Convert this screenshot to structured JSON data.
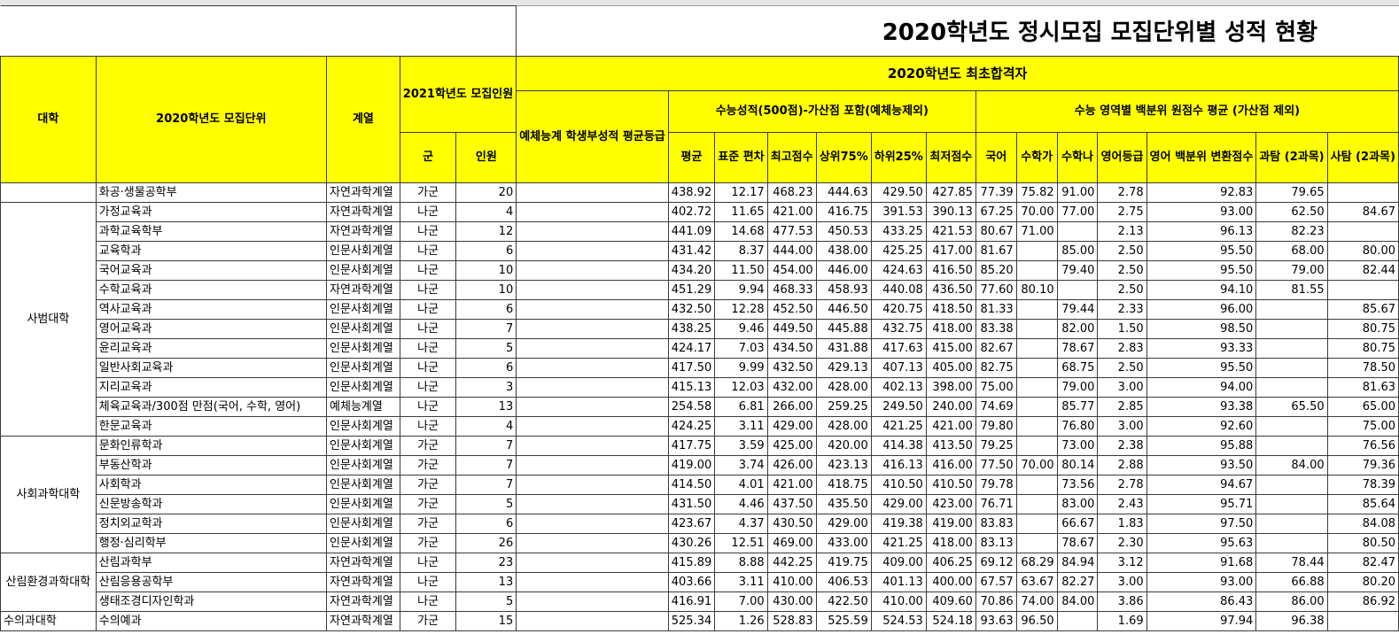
{
  "title": "2020학년도 정시모집 모집단위별 성적 현황",
  "headers": {
    "univ": "대학",
    "unit": "2020학년도 모집단위",
    "track": "계열",
    "quota2021": "2021학년도 모집인원",
    "group": "군",
    "count": "인원",
    "result_group": "2020학년도 최초합격자",
    "arts_grade": "예체능계 학생부성적 평균등급",
    "suneung_total": "수능성적(500점)-가산점 포함(예체능제외)",
    "avg": "평균",
    "std": "표준 편차",
    "max": "최고점수",
    "top75": "상위75%",
    "bottom25": "하위25%",
    "min": "최저점수",
    "pct_group": "수능 영역별 백분위 원점수 평균 (가산점 제외)",
    "korean": "국어",
    "math_ga": "수학가",
    "math_na": "수학나",
    "eng_grade": "영어등급",
    "eng_conv": "영어 백분위 변환점수",
    "sci": "과탐 (2과목)",
    "soc": "사탐 (2과목)"
  },
  "colleges": [
    {
      "name": "",
      "rows": [
        [
          "화공·생물공학부",
          "자연과학계열",
          "가군",
          "20",
          "",
          "438.92",
          "12.17",
          "468.23",
          "444.63",
          "429.50",
          "427.85",
          "77.39",
          "75.82",
          "91.00",
          "2.78",
          "92.83",
          "79.65",
          ""
        ]
      ]
    },
    {
      "name": "사범대학",
      "rows": [
        [
          "가정교육과",
          "자연과학계열",
          "나군",
          "4",
          "",
          "402.72",
          "11.65",
          "421.00",
          "416.75",
          "391.53",
          "390.13",
          "67.25",
          "70.00",
          "77.00",
          "2.75",
          "93.00",
          "62.50",
          "84.67"
        ],
        [
          "과학교육학부",
          "자연과학계열",
          "나군",
          "12",
          "",
          "441.09",
          "14.68",
          "477.53",
          "450.53",
          "433.25",
          "421.53",
          "80.67",
          "71.00",
          "",
          "2.13",
          "96.13",
          "82.23",
          ""
        ],
        [
          "교육학과",
          "인문사회계열",
          "나군",
          "6",
          "",
          "431.42",
          "8.37",
          "444.00",
          "438.00",
          "425.25",
          "417.00",
          "81.67",
          "",
          "85.00",
          "2.50",
          "95.50",
          "68.00",
          "80.00"
        ],
        [
          "국어교육과",
          "인문사회계열",
          "나군",
          "10",
          "",
          "434.20",
          "11.50",
          "454.00",
          "446.00",
          "424.63",
          "416.50",
          "85.20",
          "",
          "79.40",
          "2.50",
          "95.50",
          "79.00",
          "82.44"
        ],
        [
          "수학교육과",
          "자연과학계열",
          "나군",
          "10",
          "",
          "451.29",
          "9.94",
          "468.33",
          "458.93",
          "440.08",
          "436.50",
          "77.60",
          "80.10",
          "",
          "2.50",
          "94.10",
          "81.55",
          ""
        ],
        [
          "역사교육과",
          "인문사회계열",
          "나군",
          "6",
          "",
          "432.50",
          "12.28",
          "452.50",
          "446.50",
          "420.75",
          "418.50",
          "81.33",
          "",
          "79.44",
          "2.33",
          "96.00",
          "",
          "85.67"
        ],
        [
          "영어교육과",
          "인문사회계열",
          "나군",
          "7",
          "",
          "438.25",
          "9.46",
          "449.50",
          "445.88",
          "432.75",
          "418.00",
          "83.38",
          "",
          "82.00",
          "1.50",
          "98.50",
          "",
          "80.75"
        ],
        [
          "윤리교육과",
          "인문사회계열",
          "나군",
          "5",
          "",
          "424.17",
          "7.03",
          "434.50",
          "431.88",
          "417.63",
          "415.00",
          "82.67",
          "",
          "78.67",
          "2.83",
          "93.33",
          "",
          "80.75"
        ],
        [
          "일반사회교육과",
          "인문사회계열",
          "나군",
          "6",
          "",
          "417.50",
          "9.99",
          "432.50",
          "429.13",
          "407.13",
          "405.00",
          "82.75",
          "",
          "68.75",
          "2.50",
          "95.50",
          "",
          "78.50"
        ],
        [
          "지리교육과",
          "인문사회계열",
          "나군",
          "3",
          "",
          "415.13",
          "12.03",
          "432.00",
          "428.00",
          "402.13",
          "398.00",
          "75.00",
          "",
          "79.00",
          "3.00",
          "94.00",
          "",
          "81.63"
        ],
        [
          "체육교육과/300점 만점(국어, 수학, 영어)",
          "예체능계열",
          "나군",
          "13",
          "",
          "254.58",
          "6.81",
          "266.00",
          "259.25",
          "249.50",
          "240.00",
          "74.69",
          "",
          "85.77",
          "2.85",
          "93.38",
          "65.50",
          "65.00"
        ],
        [
          "한문교육과",
          "인문사회계열",
          "나군",
          "4",
          "",
          "424.25",
          "3.11",
          "429.00",
          "428.00",
          "421.25",
          "421.00",
          "79.80",
          "",
          "76.80",
          "3.00",
          "92.60",
          "",
          "75.00"
        ]
      ]
    },
    {
      "name": "사회과학대학",
      "rows": [
        [
          "문화인류학과",
          "인문사회계열",
          "가군",
          "7",
          "",
          "417.75",
          "3.59",
          "425.00",
          "420.00",
          "414.38",
          "413.50",
          "79.25",
          "",
          "73.00",
          "2.38",
          "95.88",
          "",
          "76.56"
        ],
        [
          "부동산학과",
          "인문사회계열",
          "가군",
          "7",
          "",
          "419.00",
          "3.74",
          "426.00",
          "423.13",
          "416.13",
          "416.00",
          "77.50",
          "70.00",
          "80.14",
          "2.88",
          "93.50",
          "84.00",
          "79.36"
        ],
        [
          "사회학과",
          "인문사회계열",
          "가군",
          "7",
          "",
          "414.50",
          "4.01",
          "421.00",
          "418.75",
          "410.50",
          "410.50",
          "79.78",
          "",
          "73.56",
          "2.78",
          "94.67",
          "",
          "78.39"
        ],
        [
          "신문방송학과",
          "인문사회계열",
          "가군",
          "5",
          "",
          "431.50",
          "4.46",
          "437.50",
          "435.50",
          "429.00",
          "423.00",
          "76.71",
          "",
          "83.00",
          "2.43",
          "95.71",
          "",
          "85.64"
        ],
        [
          "정치외교학과",
          "인문사회계열",
          "가군",
          "6",
          "",
          "423.67",
          "4.37",
          "430.50",
          "429.00",
          "419.38",
          "419.00",
          "83.83",
          "",
          "66.67",
          "1.83",
          "97.50",
          "",
          "84.08"
        ],
        [
          "행정·심리학부",
          "인문사회계열",
          "가군",
          "26",
          "",
          "430.26",
          "12.51",
          "469.00",
          "433.00",
          "421.25",
          "418.00",
          "83.13",
          "",
          "78.67",
          "2.30",
          "95.63",
          "",
          "80.50"
        ]
      ]
    },
    {
      "name": "산림환경과학대학",
      "rows": [
        [
          "산림과학부",
          "자연과학계열",
          "나군",
          "23",
          "",
          "415.89",
          "8.88",
          "442.25",
          "419.75",
          "409.00",
          "406.25",
          "69.12",
          "68.29",
          "84.94",
          "3.12",
          "91.68",
          "78.44",
          "82.47"
        ],
        [
          "산림응용공학부",
          "자연과학계열",
          "나군",
          "13",
          "",
          "403.66",
          "3.11",
          "410.00",
          "406.53",
          "401.13",
          "400.00",
          "67.57",
          "63.67",
          "82.27",
          "3.00",
          "93.00",
          "66.88",
          "80.20"
        ],
        [
          "생태조경디자인학과",
          "자연과학계열",
          "나군",
          "5",
          "",
          "416.91",
          "7.00",
          "430.00",
          "422.50",
          "410.00",
          "409.60",
          "70.86",
          "74.00",
          "84.00",
          "3.86",
          "86.43",
          "86.00",
          "86.92"
        ]
      ]
    },
    {
      "name": "수의과대학",
      "rows": [
        [
          "수의예과",
          "자연과학계열",
          "가군",
          "15",
          "",
          "525.34",
          "1.26",
          "528.83",
          "525.59",
          "524.53",
          "524.18",
          "93.63",
          "96.50",
          "",
          "1.69",
          "97.94",
          "96.38",
          ""
        ]
      ]
    }
  ]
}
